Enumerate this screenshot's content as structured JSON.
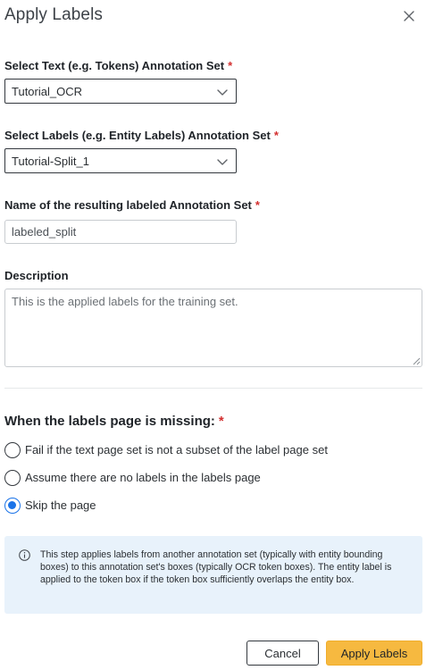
{
  "dialog": {
    "title": "Apply Labels",
    "close_icon": "close-icon"
  },
  "fields": {
    "text_set": {
      "label": "Select Text (e.g. Tokens) Annotation Set",
      "required": "*",
      "value": "Tutorial_OCR"
    },
    "labels_set": {
      "label": "Select Labels (e.g. Entity Labels) Annotation Set",
      "required": "*",
      "value": "Tutorial-Split_1"
    },
    "result_name": {
      "label": "Name of the resulting labeled Annotation Set",
      "required": "*",
      "value": "labeled_split"
    },
    "description": {
      "label": "Description",
      "value": "This is the applied labels for the training set."
    }
  },
  "missing_page": {
    "title": "When the labels page is missing:",
    "required": "*",
    "options": [
      {
        "label": "Fail if the text page set is not a subset of the label page set",
        "checked": false
      },
      {
        "label": "Assume there are no labels in the labels page",
        "checked": false
      },
      {
        "label": "Skip the page",
        "checked": true
      }
    ]
  },
  "info": {
    "icon": "info-icon",
    "text": "This step applies labels from another annotation set (typically with entity bounding boxes) to this annotation set's boxes (typically OCR token boxes). The entity label is applied to the token box if the token box sufficiently overlaps the entity box."
  },
  "buttons": {
    "cancel": "Cancel",
    "apply": "Apply Labels"
  },
  "colors": {
    "accent": "#1a73e8",
    "primary_button": "#f6b940",
    "info_background": "#e8f2fb",
    "required": "#d32f2f"
  }
}
